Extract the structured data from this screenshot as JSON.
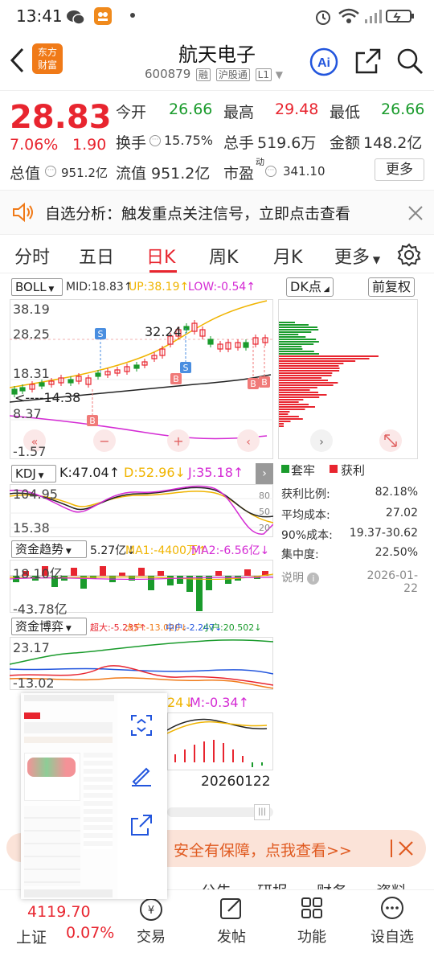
{
  "status": {
    "time": "13:41"
  },
  "header": {
    "title": "航天电子",
    "code": "600879",
    "tag1": "融",
    "tag2": "沪股通",
    "tag3": "L1"
  },
  "quote": {
    "price": "28.83",
    "pct": "7.06%",
    "chg": "1.90",
    "open_label": "今开",
    "open": "26.66",
    "high_label": "最高",
    "high": "29.48",
    "low_label": "最低",
    "low": "26.66",
    "turnover_label": "换手",
    "turnover": "15.75%",
    "volume_label": "总手",
    "volume": "519.6万",
    "amount_label": "金额",
    "amount": "148.2亿",
    "mcap_label": "总值",
    "mcap": "951.2亿",
    "float_label": "流值",
    "float": "951.2亿",
    "pe_label": "市盈",
    "pe_sup": "动",
    "pe": "341.10",
    "more": "更多"
  },
  "notice": {
    "text": "自选分析：触发重点关注信号，立即点击查看"
  },
  "tabs": [
    "分时",
    "五日",
    "日K",
    "周K",
    "月K",
    "更多"
  ],
  "boll": {
    "name": "BOLL",
    "mid": "MID:18.83↑",
    "up": "UP:38.19↑",
    "low": "LOW:-0.54↑",
    "y_labels": [
      "38.19",
      "28.25",
      "18.31",
      "8.37",
      "-1.57"
    ],
    "hi_mark": "32.24",
    "lo_mark": "<----14.38",
    "dk": "DK点",
    "fuquan": "前复权"
  },
  "chip": {
    "legend_trapped": "套牢",
    "legend_profit": "获利",
    "rows": [
      {
        "label": "获利比例:",
        "value": "82.18%"
      },
      {
        "label": "平均成本:",
        "value": "27.02"
      },
      {
        "label": "90%成本:",
        "value": "19.37-30.62"
      },
      {
        "label": "集中度:",
        "value": "22.50%"
      }
    ],
    "note": "说明",
    "date": "2026-01-22"
  },
  "kdj": {
    "name": "KDJ",
    "k": "K:47.04↑",
    "d": "D:52.96↓",
    "j": "J:35.18↑",
    "y_labels": [
      "104.95",
      "15.38"
    ],
    "r_labels": [
      "80",
      "50",
      "20"
    ]
  },
  "fund_trend": {
    "name": "资金趋势",
    "v": "5.27亿↓",
    "ma1": "MA1:-4400万↑",
    "ma2": "MA2:-6.56亿↓",
    "y_labels": [
      "18.10亿",
      "-43.78亿"
    ]
  },
  "fund_game": {
    "name": "资金博弈",
    "super": "超大:-5.235↑",
    "big": "大户:-13.020↓",
    "mid": "中户:-2.247↓",
    "small": "小户:20.502↓",
    "y_labels": [
      "23.17",
      "-13.02"
    ]
  },
  "macd": {
    "partial": "24↓",
    "m": "M:-0.34↑",
    "date": "20260122"
  },
  "banner": {
    "text": "安全有保障，点我查看>>"
  },
  "bottom": {
    "index_val": "4119.70",
    "index_name": "上证",
    "index_pct": "0.07%",
    "nav": [
      "交易",
      "发帖",
      "功能",
      "设自选"
    ],
    "behind_tabs": [
      "公告",
      "研报",
      "财务",
      "资料"
    ]
  },
  "colors": {
    "red": "#e8252f",
    "green": "#1a9b2c",
    "gold": "#f0b400",
    "magenta": "#d42bd4"
  }
}
